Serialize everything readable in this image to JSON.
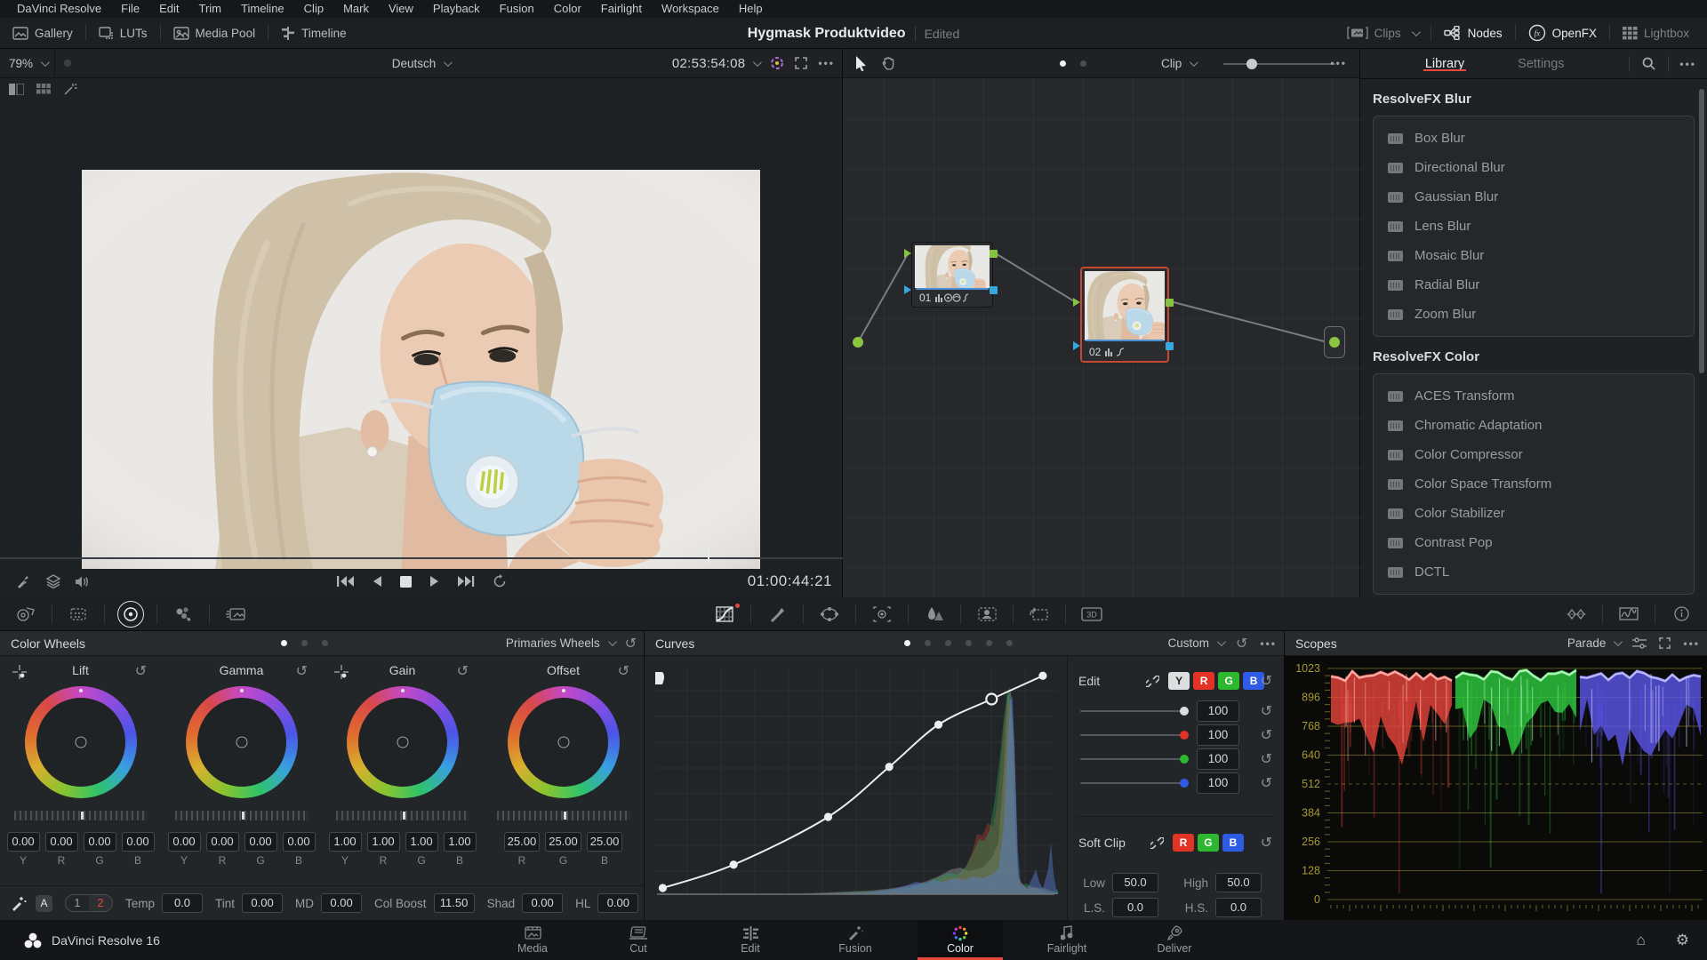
{
  "menu_bar": {
    "items": [
      "DaVinci Resolve",
      "File",
      "Edit",
      "Trim",
      "Timeline",
      "Clip",
      "Mark",
      "View",
      "Playback",
      "Fusion",
      "Color",
      "Fairlight",
      "Workspace",
      "Help"
    ]
  },
  "top_toolbar": {
    "left_buttons": [
      {
        "label": "Gallery",
        "icon": "gallery"
      },
      {
        "label": "LUTs",
        "icon": "luts"
      },
      {
        "label": "Media Pool",
        "icon": "mediapool"
      },
      {
        "label": "Timeline",
        "icon": "timeline"
      }
    ],
    "title": "Hygmask Produktvideo",
    "title_status": "Edited",
    "right_buttons": [
      {
        "label": "Clips",
        "icon": "clips",
        "state": "dim",
        "chevron": true
      },
      {
        "label": "Nodes",
        "icon": "nodes",
        "state": "lit"
      },
      {
        "label": "OpenFX",
        "icon": "openfx",
        "state": "lit"
      },
      {
        "label": "Lightbox",
        "icon": "lightbox",
        "state": "dim"
      }
    ]
  },
  "viewer": {
    "zoom_level": "79%",
    "language": "Deutsch",
    "source_timecode": "02:53:54:08",
    "record_timecode": "01:00:44:21"
  },
  "node_editor": {
    "mode_label": "Clip",
    "nodes": [
      {
        "label": "01"
      },
      {
        "label": "02"
      }
    ]
  },
  "fx_panel": {
    "tabs": [
      {
        "label": "Library",
        "active": true
      },
      {
        "label": "Settings",
        "active": false
      }
    ],
    "groups": [
      {
        "title": "ResolveFX Blur",
        "items": [
          "Box Blur",
          "Directional Blur",
          "Gaussian Blur",
          "Lens Blur",
          "Mosaic Blur",
          "Radial Blur",
          "Zoom Blur"
        ]
      },
      {
        "title": "ResolveFX Color",
        "items": [
          "ACES Transform",
          "Chromatic Adaptation",
          "Color Compressor",
          "Color Space Transform",
          "Color Stabilizer",
          "Contrast Pop",
          "DCTL"
        ]
      }
    ]
  },
  "color_wheels": {
    "title": "Color Wheels",
    "mode": "Primaries Wheels",
    "wheels": [
      {
        "name": "Lift",
        "crosshair": true,
        "channels": [
          "Y",
          "R",
          "G",
          "B"
        ],
        "values": [
          "0.00",
          "0.00",
          "0.00",
          "0.00"
        ]
      },
      {
        "name": "Gamma",
        "crosshair": false,
        "channels": [
          "Y",
          "R",
          "G",
          "B"
        ],
        "values": [
          "0.00",
          "0.00",
          "0.00",
          "0.00"
        ]
      },
      {
        "name": "Gain",
        "crosshair": true,
        "channels": [
          "Y",
          "R",
          "G",
          "B"
        ],
        "values": [
          "1.00",
          "1.00",
          "1.00",
          "1.00"
        ]
      },
      {
        "name": "Offset",
        "crosshair": false,
        "channels": [
          "R",
          "G",
          "B"
        ],
        "values": [
          "25.00",
          "25.00",
          "25.00"
        ]
      }
    ],
    "auto_badge": "A",
    "page_toggle": [
      "1",
      "2"
    ],
    "active_page": "2",
    "adjustments": [
      {
        "label": "Temp",
        "value": "0.0"
      },
      {
        "label": "Tint",
        "value": "0.00"
      },
      {
        "label": "MD",
        "value": "0.00"
      },
      {
        "label": "Col Boost",
        "value": "11.50"
      },
      {
        "label": "Shad",
        "value": "0.00"
      },
      {
        "label": "HL",
        "value": "0.00"
      }
    ]
  },
  "curves": {
    "title": "Curves",
    "mode": "Custom",
    "edit": {
      "label": "Edit",
      "channels": [
        "Y",
        "R",
        "G",
        "B"
      ],
      "slider_values": [
        "100",
        "100",
        "100",
        "100"
      ]
    },
    "soft_clip": {
      "label": "Soft Clip",
      "channels": [
        "R",
        "G",
        "B"
      ],
      "fields": [
        {
          "label": "Low",
          "value": "50.0"
        },
        {
          "label": "High",
          "value": "50.0"
        },
        {
          "label": "L.S.",
          "value": "0.0"
        },
        {
          "label": "H.S.",
          "value": "0.0"
        }
      ]
    },
    "points": [
      [
        0.01,
        0.02
      ],
      [
        0.19,
        0.125
      ],
      [
        0.43,
        0.34
      ],
      [
        0.585,
        0.565
      ],
      [
        0.71,
        0.755
      ],
      [
        0.845,
        0.87
      ],
      [
        0.975,
        0.975
      ]
    ],
    "selected_point_index": 5
  },
  "scopes": {
    "title": "Scopes",
    "mode": "Parade",
    "scale": [
      1023,
      896,
      768,
      640,
      512,
      384,
      256,
      128,
      0
    ]
  },
  "page_bar": {
    "app_label": "DaVinci Resolve 16",
    "pages": [
      "Media",
      "Cut",
      "Edit",
      "Fusion",
      "Color",
      "Fairlight",
      "Deliver"
    ],
    "active_page": "Color"
  }
}
